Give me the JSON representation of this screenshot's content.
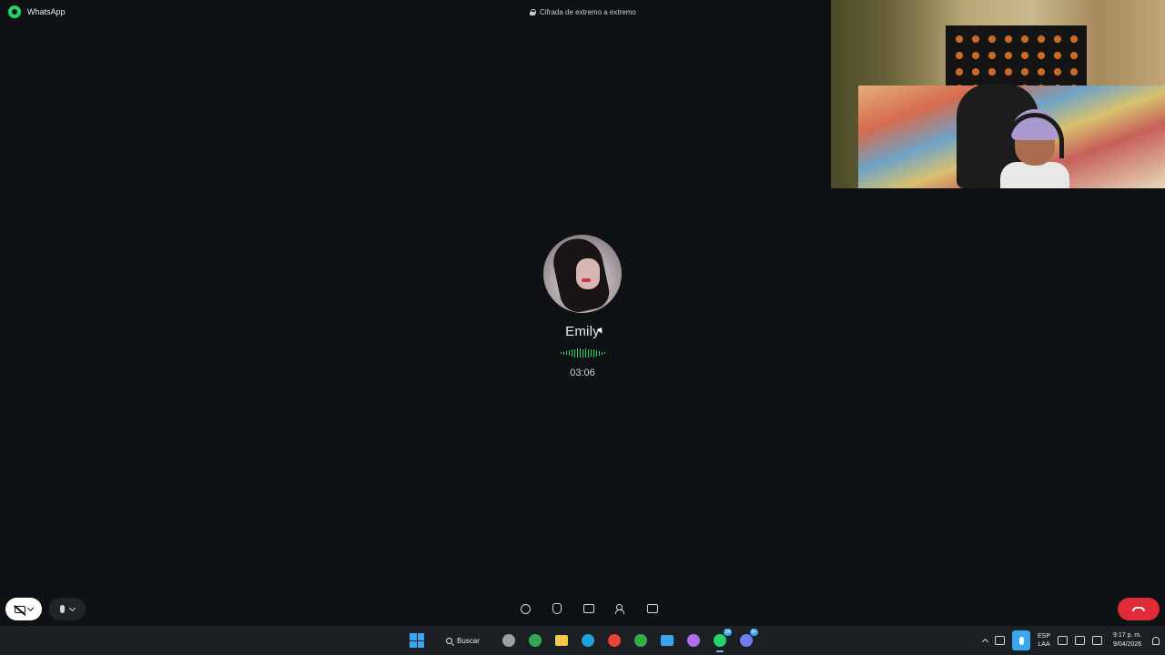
{
  "titlebar": {
    "app_name": "WhatsApp",
    "encryption_notice": "Cifrada de extremo a extremo"
  },
  "call": {
    "contact_name": "Emily",
    "duration": "03:06",
    "status_color": "#25d366"
  },
  "controls": {
    "end_call_color": "#e02b38",
    "center_tools": [
      "emoji-icon",
      "raise-hand-icon",
      "screen-share-icon",
      "add-person-icon",
      "more-options-icon"
    ]
  },
  "taskbar": {
    "search_label": "Buscar",
    "apps": [
      {
        "name": "copilot-icon",
        "color": "#9aa0a6"
      },
      {
        "name": "chrome-icon",
        "color": "#34a853",
        "badge": ""
      },
      {
        "name": "file-explorer-icon",
        "color": "#f2c94c"
      },
      {
        "name": "edge-icon",
        "color": "#1ea0e0"
      },
      {
        "name": "chrome-icon",
        "color": "#ea4335"
      },
      {
        "name": "xbox-icon",
        "color": "#2fb344"
      },
      {
        "name": "photos-icon",
        "color": "#3aa6f0"
      },
      {
        "name": "copilot-app-icon",
        "color": "#b16cf0"
      },
      {
        "name": "whatsapp-icon",
        "color": "#25d366",
        "badge": "34"
      },
      {
        "name": "discord-icon",
        "color": "#6f7bf0",
        "badge": "9+"
      }
    ],
    "language_line1": "ESP",
    "language_line2": "LAA",
    "time": "9:17 p. m.",
    "date": "9/04/2026"
  }
}
